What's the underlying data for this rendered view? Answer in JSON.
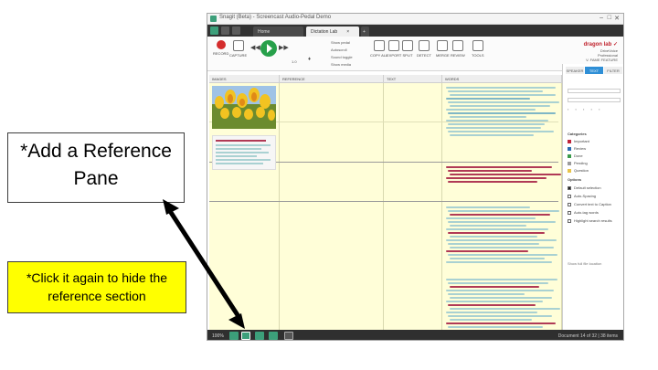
{
  "window": {
    "title": "Snagit (Beta) - Screencast Audio-Pedal Demo",
    "controls": [
      "–",
      "□",
      "✕"
    ]
  },
  "tabs": [
    {
      "label": "Home",
      "active": false
    },
    {
      "label": "Dictation Lab",
      "active": true
    }
  ],
  "ribbon": {
    "record_label": "RECORD",
    "capture_label": "CAPTURE",
    "speed": "1.0",
    "options": [
      "Show pedal",
      "Autoscroll",
      "Sound toggle",
      "Show media"
    ],
    "tools": [
      "COPY ALL",
      "EXPORT",
      "SPLIT",
      "DETECT",
      "MERGE",
      "REVIEW",
      "TOOLS"
    ],
    "brand": "dragon lab ✓",
    "brand_sub": [
      "DriveVoice",
      "Professional",
      "V. FAME FEATURE"
    ]
  },
  "columns": {
    "images": "IMAGES",
    "reference": "REFERENCE",
    "text": "TEXT",
    "words": "WORDS"
  },
  "panel": {
    "tabs": [
      "SPEAKER",
      "TEXT",
      "FILTER"
    ],
    "categories_title": "Categories",
    "categories": [
      {
        "label": "Important",
        "color": "#c0233a"
      },
      {
        "label": "Review",
        "color": "#2b6bb0"
      },
      {
        "label": "Done",
        "color": "#3a9a4a"
      },
      {
        "label": "Pending",
        "color": "#9c9c9c"
      },
      {
        "label": "Question",
        "color": "#e8c44a"
      }
    ],
    "options_title": "Options",
    "options": [
      "Default selection",
      "Auto-Spacing",
      "Convert text to Caption",
      "Auto-tag words",
      "Highlight search results"
    ],
    "footer": "Show full file location"
  },
  "bottom": {
    "zoom": "100%",
    "status": "Document 14 of 32 | 38 items"
  },
  "callouts": {
    "main": "*Add a Reference Pane",
    "note": "*Click it again to hide the reference section"
  },
  "colors": {
    "bar_teal": "#a9d1d2",
    "bar_blue": "#7fb7c6",
    "bar_red": "#b03a56",
    "arrow": "#000000",
    "callout_note": "#ffff00"
  }
}
